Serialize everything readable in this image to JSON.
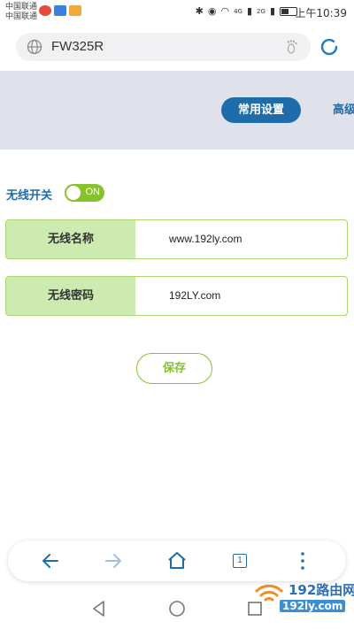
{
  "status_bar": {
    "carrier_1": "中国联通",
    "carrier_2": "中国联通",
    "network_4g": "4G",
    "network_2g": "2G",
    "time": "上午10:39"
  },
  "browser": {
    "url": "FW325R",
    "tabs_count": "1"
  },
  "router": {
    "tabs": [
      {
        "label": "常用设置",
        "active": true
      },
      {
        "label": "高级"
      }
    ],
    "wifi_switch_label": "无线开关",
    "wifi_switch_state": "ON",
    "ssid_label": "无线名称",
    "ssid_value": "www.192ly.com",
    "password_label": "无线密码",
    "password_value": "192LY.com",
    "save_label": "保存"
  },
  "watermark": {
    "brand": "192路由网",
    "url": "192ly.com"
  },
  "colors": {
    "accent_blue": "#1f6cab",
    "accent_green": "#86c22b",
    "label_green_bg": "#cdeab0",
    "header_bg": "#dfe2ea"
  }
}
